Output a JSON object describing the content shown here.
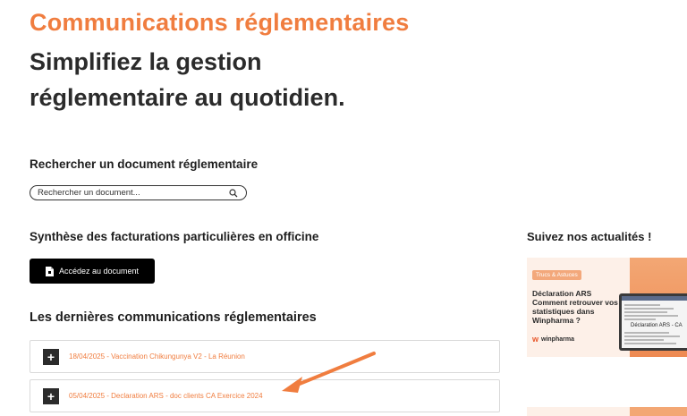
{
  "header": {
    "title": "Communications réglementaires",
    "subtitle_line1": "Simplifiez la gestion",
    "subtitle_line2": "réglementaire au quotidien."
  },
  "search": {
    "label": "Rechercher un document réglementaire",
    "placeholder": "Rechercher un document..."
  },
  "synthese": {
    "label": "Synthèse des facturations particulières en officine",
    "button_label": "Accédez au document"
  },
  "latest": {
    "label": "Les dernières communications réglementaires",
    "items": [
      {
        "text": "18/04/2025 - Vaccination Chikungunya V2 - La Réunion"
      },
      {
        "text": "05/04/2025 - Declaration ARS - doc clients CA Exercice 2024"
      }
    ]
  },
  "news": {
    "label": "Suivez nos actualités !",
    "card": {
      "tag": "Trucs & Astuces",
      "headline": "Déclaration ARS Comment retrouver vos statistiques dans Winpharma ?",
      "brand": "winpharma",
      "screen_text": "Déclaration ARS - CA"
    }
  },
  "colors": {
    "accent": "#f07d3f",
    "dark_text": "#2b2b2b",
    "button_bg": "#000000"
  },
  "icons": {
    "search": "search-icon",
    "document": "document-icon",
    "expand": "plus-icon"
  }
}
